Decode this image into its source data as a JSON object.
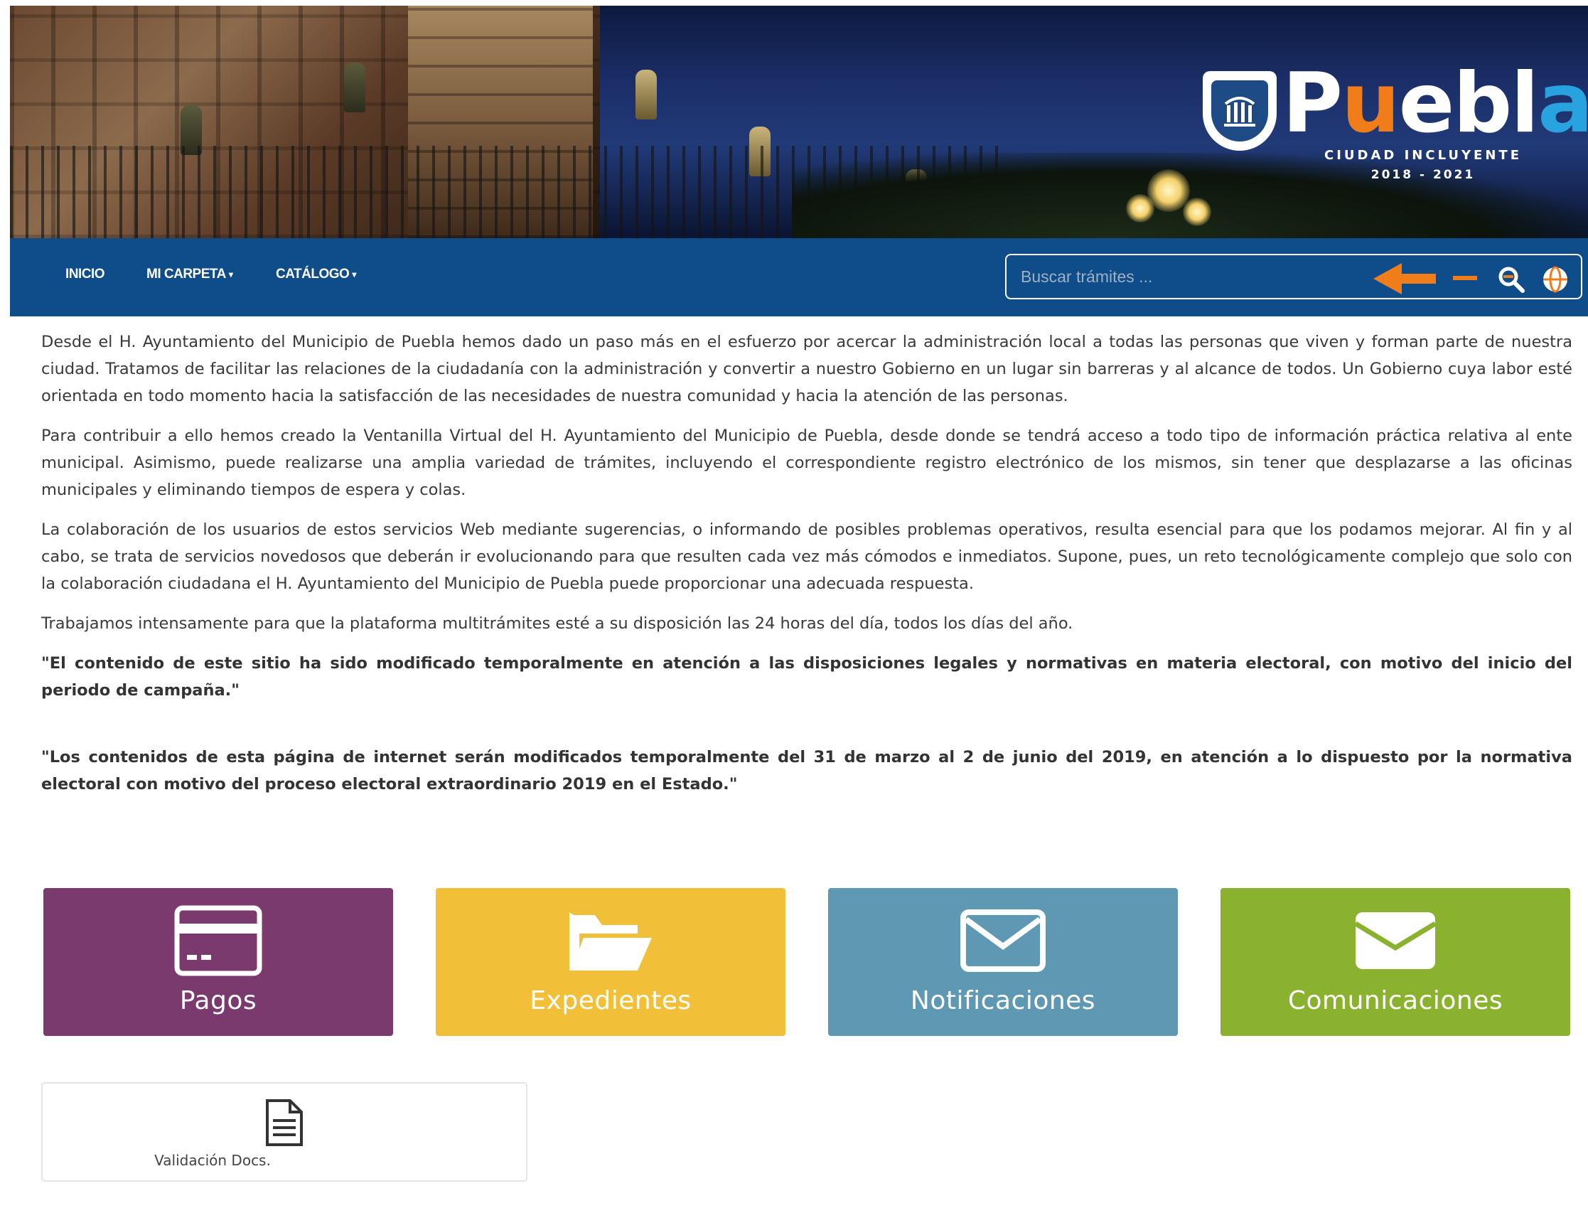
{
  "header": {
    "logo": {
      "wordmark": "Puebla",
      "tagline": "CIUDAD INCLUYENTE",
      "years": "2018 - 2021"
    }
  },
  "navbar": {
    "items": [
      {
        "label": "INICIO",
        "has_dropdown": false
      },
      {
        "label": "MI CARPETA",
        "has_dropdown": true
      },
      {
        "label": "CATÁLOGO",
        "has_dropdown": true
      }
    ],
    "search": {
      "placeholder": "Buscar trámites ..."
    },
    "icons": [
      "arrow-left-icon",
      "minus-icon",
      "zoom-out-icon",
      "globe-icon"
    ],
    "accent_color": "#f07d1a",
    "background_color": "#0f4c8a"
  },
  "content": {
    "paragraphs": [
      "Desde el H. Ayuntamiento del Municipio de Puebla hemos dado un paso más en el esfuerzo por acercar la administración local a todas las personas que viven y forman parte de nuestra ciudad. Tratamos de facilitar las relaciones de la ciudadanía con la administración y convertir a nuestro Gobierno en un lugar sin barreras y al alcance de todos. Un Gobierno cuya labor esté orientada en todo momento hacia la satisfacción de las necesidades de nuestra comunidad y hacia la atención de las personas.",
      "Para contribuir a ello hemos creado la Ventanilla Virtual del H. Ayuntamiento del Municipio de Puebla, desde donde se tendrá acceso a todo tipo de información práctica relativa al ente municipal. Asimismo, puede realizarse una amplia variedad de trámites, incluyendo el correspondiente registro electrónico de los mismos, sin tener que desplazarse a las oficinas municipales y eliminando tiempos de espera y colas.",
      "La colaboración de los usuarios de estos servicios Web mediante sugerencias, o informando de posibles problemas operativos, resulta esencial para que los podamos mejorar. Al fin y al cabo, se trata de servicios novedosos que deberán ir evolucionando para que resulten cada vez más cómodos e inmediatos. Supone, pues, un reto tecnológicamente complejo que solo con la colaboración ciudadana el H. Ayuntamiento del Municipio de Puebla puede proporcionar una adecuada respuesta.",
      "Trabajamos intensamente para que la plataforma multitrámites esté a su disposición las 24 horas del día, todos los días del año."
    ],
    "notice_1": "\"El contenido de este sitio ha sido modificado temporalmente en atención a las disposiciones legales y normativas en materia electoral, con motivo del inicio del periodo de campaña.\"",
    "notice_2": "\"Los contenidos de esta página de internet serán modificados temporalmente del 31 de marzo al 2 de junio del 2019, en atención a lo dispuesto por la normativa electoral con motivo del proceso electoral extraordinario 2019 en el Estado.\""
  },
  "tiles": [
    {
      "label": "Pagos",
      "icon": "credit-card-icon",
      "color": "#7a3a6e"
    },
    {
      "label": "Expedientes",
      "icon": "folder-open-icon",
      "color": "#f2bf38"
    },
    {
      "label": "Notificaciones",
      "icon": "envelope-icon",
      "color": "#5e98b3"
    },
    {
      "label": "Comunicaciones",
      "icon": "envelope-icon",
      "color": "#8ab22e"
    }
  ],
  "validation": {
    "label": "Validación Docs.",
    "icon": "document-icon"
  }
}
